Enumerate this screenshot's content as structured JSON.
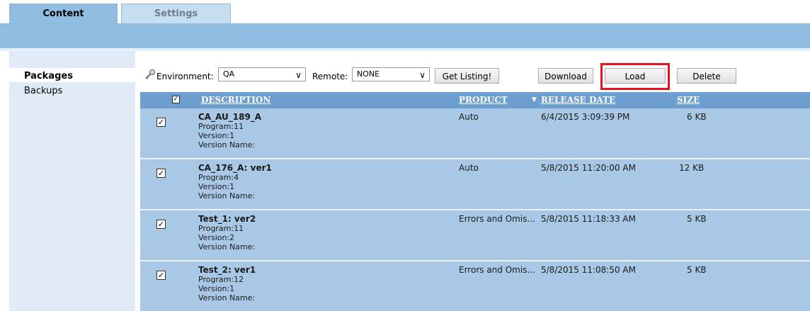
{
  "tabs": [
    {
      "label": "Content",
      "active": true
    },
    {
      "label": "Settings",
      "active": false
    }
  ],
  "sidebar": {
    "items": [
      {
        "label": "Packages",
        "selected": true
      },
      {
        "label": "Backups",
        "selected": false
      }
    ]
  },
  "toolbar": {
    "environment_label": "Environment:",
    "environment_value": "QA",
    "remote_label": "Remote:",
    "remote_value": "NONE",
    "get_listing_label": "Get Listing!",
    "download_label": "Download",
    "load_label": "Load",
    "delete_label": "Delete"
  },
  "table": {
    "columns": [
      "DESCRIPTION",
      "PRODUCT",
      "RELEASE DATE",
      "SIZE"
    ],
    "sort_indicator": "▼",
    "rows": [
      {
        "checked": true,
        "title": "CA_AU_189_A",
        "program": "Program:11",
        "version": "Version:1",
        "version_name": "Version Name:",
        "product": "Auto",
        "release_date": "6/4/2015 3:09:39 PM",
        "size": "6 KB"
      },
      {
        "checked": true,
        "title": "CA_176_A: ver1",
        "program": "Program:4",
        "version": "Version:1",
        "version_name": "Version Name:",
        "product": "Auto",
        "release_date": "5/8/2015 11:20:00 AM",
        "size": "12 KB"
      },
      {
        "checked": true,
        "title": "Test_1: ver2",
        "program": "Program:11",
        "version": "Version:2",
        "version_name": "Version Name:",
        "product": "Errors and Omis...",
        "release_date": "5/8/2015 11:18:33 AM",
        "size": "5 KB"
      },
      {
        "checked": true,
        "title": "Test_2: ver1",
        "program": "Program:12",
        "version": "Version:1",
        "version_name": "Version Name:",
        "product": "Errors and Omis...",
        "release_date": "5/8/2015 11:08:50 AM",
        "size": "5 KB"
      }
    ]
  },
  "colors": {
    "tab_active": "#92bde2",
    "header_bg": "#6c9fd0",
    "row_bg": "#a8c8e5",
    "highlight": "#e8141b"
  }
}
